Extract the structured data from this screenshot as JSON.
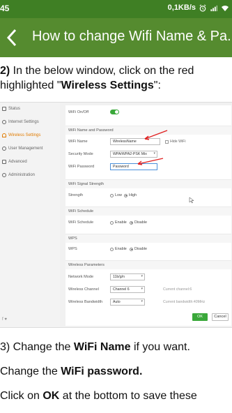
{
  "status_bar": {
    "time": "45",
    "net_speed": "0,1KB/s",
    "icons": [
      "alarm-icon",
      "signal-icon",
      "wifi-icon"
    ]
  },
  "app_bar": {
    "back_icon": "arrow-back-icon",
    "title": "How to change Wifi Name & Pa..."
  },
  "step2": {
    "number": "2)",
    "text_line1": " In the below window, click on the red",
    "text_line2_prefix": "highlighted \"",
    "highlight": "Wireless Settings",
    "text_line2_suffix": "\":"
  },
  "router": {
    "sidebar": [
      {
        "label": "Status",
        "icon": "status-icon",
        "active": false
      },
      {
        "label": "Internet Settings",
        "icon": "globe-icon",
        "active": false
      },
      {
        "label": "Wireless Settings",
        "icon": "wifi-icon",
        "active": true
      },
      {
        "label": "User Management",
        "icon": "user-icon",
        "active": false
      },
      {
        "label": "Advanced",
        "icon": "advanced-icon",
        "active": false
      },
      {
        "label": "Administration",
        "icon": "admin-icon",
        "active": false
      }
    ],
    "sidebar_footer": "f ♥",
    "wifi_onoff_label": "WiFi On/Off",
    "section_name_password": "WiFi Name and Password",
    "wifi_name_label": "WiFi Name",
    "wifi_name_value": "WirelessName",
    "hide_wifi_label": "Hide WiFi",
    "security_mode_label": "Security Mode",
    "security_mode_value": "WPA/WPA2-PSK Mix",
    "wifi_password_label": "WiFi Password",
    "wifi_password_value": "Password",
    "section_signal": "WiFi Signal Strength",
    "strength_label": "Strength",
    "strength_low": "Low",
    "strength_high": "High",
    "section_schedule": "WiFi Schedule",
    "schedule_label": "WiFi Schedule",
    "schedule_enable": "Enable",
    "schedule_disable": "Disable",
    "section_wps": "WPS",
    "wps_label": "WPS",
    "wps_enable": "Enable",
    "wps_disable": "Disable",
    "section_params": "Wireless Parameters",
    "network_mode_label": "Network Mode",
    "network_mode_value": "11b/g/n",
    "channel_label": "Wireless Channel",
    "channel_value": "Channel 6",
    "channel_hint": "Current channel:6",
    "bandwidth_label": "Wireless Bandwidth",
    "bandwidth_value": "Auto",
    "bandwidth_hint": "Current bandwidth:40MHz",
    "ok_label": "OK",
    "cancel_label": "Cancel",
    "arrow_color": "#e02020"
  },
  "step3": {
    "number": "3)",
    "prefix": " Change the ",
    "bold": "WiFi Name",
    "suffix": " if you want."
  },
  "step4": {
    "prefix": "Change the ",
    "bold": "WiFi password."
  },
  "step5": {
    "prefix": "Click on  ",
    "bold": "OK",
    "suffix": " at the bottom to save these"
  },
  "colors": {
    "status_bar": "#3f7f24",
    "app_bar": "#558b2f",
    "active_menu": "#e07b00",
    "ok_button": "#3aa83a"
  }
}
